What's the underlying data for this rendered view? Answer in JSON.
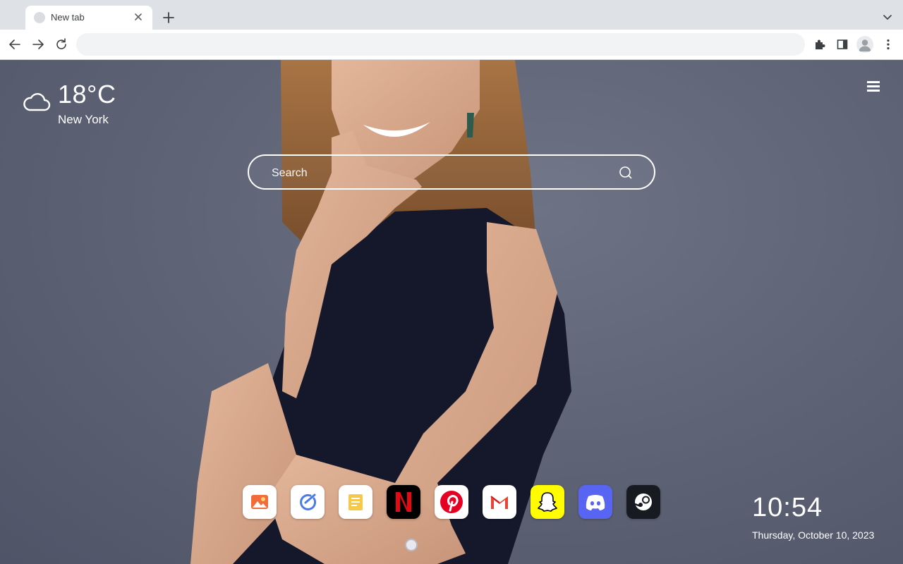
{
  "browser": {
    "tab": {
      "title": "New tab"
    },
    "omnibox": {
      "value": "",
      "placeholder": ""
    }
  },
  "weather": {
    "temperature": "18°C",
    "city": "New York",
    "icon": "cloud-icon"
  },
  "search": {
    "placeholder": "Search"
  },
  "apps": [
    {
      "name": "photos-app",
      "icon": "image-icon"
    },
    {
      "name": "tasks-app",
      "icon": "check-circle-icon"
    },
    {
      "name": "notes-app",
      "icon": "note-icon"
    },
    {
      "name": "netflix-app",
      "icon": "netflix-icon"
    },
    {
      "name": "pinterest-app",
      "icon": "pinterest-icon"
    },
    {
      "name": "gmail-app",
      "icon": "gmail-icon"
    },
    {
      "name": "snapchat-app",
      "icon": "snapchat-icon"
    },
    {
      "name": "discord-app",
      "icon": "discord-icon"
    },
    {
      "name": "steam-app",
      "icon": "steam-icon"
    }
  ],
  "clock": {
    "time": "10:54",
    "date": "Thursday, October 10, 2023"
  },
  "colors": {
    "netflix": "#e50914",
    "pinterest": "#e60023",
    "snapchat": "#fffc00",
    "discord": "#5865f2",
    "steam": "#171a21"
  }
}
